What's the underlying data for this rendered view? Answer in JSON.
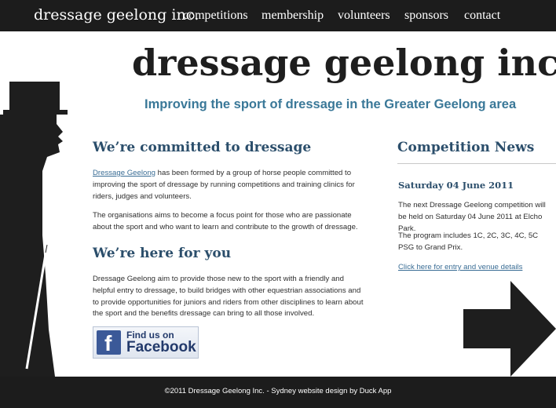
{
  "header": {
    "brand": "dressage geelong inc.",
    "nav": [
      "competitions",
      "membership",
      "volunteers",
      "sponsors",
      "contact"
    ]
  },
  "hero": {
    "title": "dressage geelong inc.",
    "tagline": "Improving the sport of dressage in the Greater Geelong area"
  },
  "main": {
    "committed_heading": "We’re committed to dressage",
    "intro_link": "Dressage Geelong",
    "intro_rest": " has been formed by a group of horse people committed to improving the sport of dressage by running competitions and training clinics for riders, judges and volunteers.",
    "focus_para": "The organisations aims to become a focus point for those who are passionate about the sport and who want to learn and contribute to the growth of dressage.",
    "here_heading": "We’re here for you",
    "here_para": "Dressage Geelong aim to provide those new to the sport with a friendly and helpful entry to dressage, to build bridges with other equestrian associations and to provide opportunities for juniors and riders from other disciplines to learn about the sport and the benefits dressage can bring to all those involved.",
    "facebook": {
      "small": "Find us on",
      "big": "Facebook",
      "icon": "facebook-f"
    }
  },
  "news": {
    "heading": "Competition News",
    "date": "Saturday 04 June 2011",
    "para1": "The next Dressage Geelong competition will be held on Saturday 04 June 2011 at Elcho Park.",
    "para2": "The program includes 1C, 2C, 3C, 4C, 5C PSG to Grand Prix.",
    "link": "Click here for entry and venue details"
  },
  "footer": {
    "text": "©2011 Dressage Geelong Inc. - Sydney website design by Duck App"
  },
  "colors": {
    "bar": "#1c1c1c",
    "heading": "#2b4e6b",
    "tagline": "#3a7898",
    "link": "#3a6d95",
    "facebook": "#3b5998"
  }
}
